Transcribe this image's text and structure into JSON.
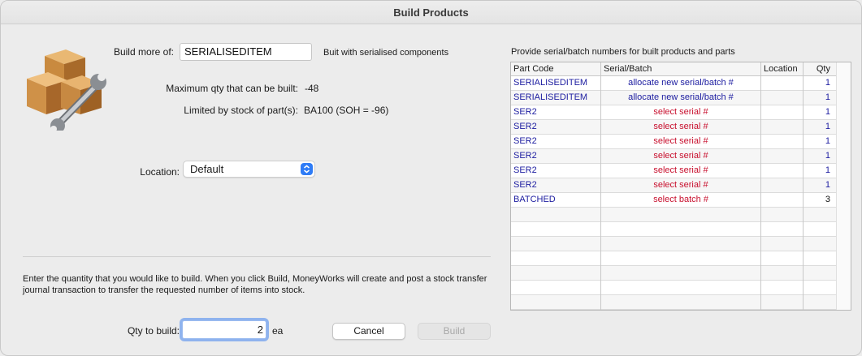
{
  "window": {
    "title": "Build Products"
  },
  "form": {
    "build_more_label": "Build more of:",
    "build_more_value": "SERIALISEDITEM",
    "build_note": "Buit with serialised components",
    "max_qty_label": "Maximum qty that can be built:",
    "max_qty_value": "-48",
    "limited_label": "Limited by stock of part(s):",
    "limited_value": "BA100 (SOH = -96)",
    "location_label": "Location:",
    "location_value": "Default"
  },
  "description": "Enter the quantity that you would like to build. When you click Build, MoneyWorks will create and post a stock transfer journal transaction to transfer the requested number of items into stock.",
  "qty": {
    "label": "Qty to build:",
    "value": "2",
    "unit": "ea"
  },
  "buttons": {
    "cancel": "Cancel",
    "build": "Build"
  },
  "grid": {
    "title": "Provide serial/batch numbers for built products and parts",
    "headers": {
      "part_code": "Part Code",
      "serial": "Serial/Batch",
      "location": "Location",
      "qty": "Qty"
    },
    "rows": [
      {
        "part": "SERIALISEDITEM",
        "serial": "allocate new serial/batch #",
        "location": "",
        "qty": "1",
        "serial_color": "#1c1ca0",
        "qty_color": "#1c1ca0"
      },
      {
        "part": "SERIALISEDITEM",
        "serial": "allocate new serial/batch #",
        "location": "",
        "qty": "1",
        "serial_color": "#1c1ca0",
        "qty_color": "#1c1ca0"
      },
      {
        "part": "SER2",
        "serial": "select serial #",
        "location": "",
        "qty": "1",
        "serial_color": "#c8102e",
        "qty_color": "#1c1ca0"
      },
      {
        "part": "SER2",
        "serial": "select serial #",
        "location": "",
        "qty": "1",
        "serial_color": "#c8102e",
        "qty_color": "#1c1ca0"
      },
      {
        "part": "SER2",
        "serial": "select serial #",
        "location": "",
        "qty": "1",
        "serial_color": "#c8102e",
        "qty_color": "#1c1ca0"
      },
      {
        "part": "SER2",
        "serial": "select serial #",
        "location": "",
        "qty": "1",
        "serial_color": "#c8102e",
        "qty_color": "#1c1ca0"
      },
      {
        "part": "SER2",
        "serial": "select serial #",
        "location": "",
        "qty": "1",
        "serial_color": "#c8102e",
        "qty_color": "#1c1ca0"
      },
      {
        "part": "SER2",
        "serial": "select serial #",
        "location": "",
        "qty": "1",
        "serial_color": "#c8102e",
        "qty_color": "#1c1ca0"
      },
      {
        "part": "BATCHED",
        "serial": "select batch #",
        "location": "",
        "qty": "3",
        "serial_color": "#c8102e",
        "qty_color": "#111111"
      },
      {
        "part": "",
        "serial": "",
        "location": "",
        "qty": ""
      },
      {
        "part": "",
        "serial": "",
        "location": "",
        "qty": ""
      },
      {
        "part": "",
        "serial": "",
        "location": "",
        "qty": ""
      },
      {
        "part": "",
        "serial": "",
        "location": "",
        "qty": ""
      },
      {
        "part": "",
        "serial": "",
        "location": "",
        "qty": ""
      },
      {
        "part": "",
        "serial": "",
        "location": "",
        "qty": ""
      },
      {
        "part": "",
        "serial": "",
        "location": "",
        "qty": ""
      }
    ]
  },
  "icons": {
    "product": "boxes-wrench-icon",
    "popup": "updown-chevron-icon"
  },
  "colors": {
    "accent": "#2f7cf6",
    "part_code": "#1c1ca0",
    "warning": "#c8102e"
  }
}
